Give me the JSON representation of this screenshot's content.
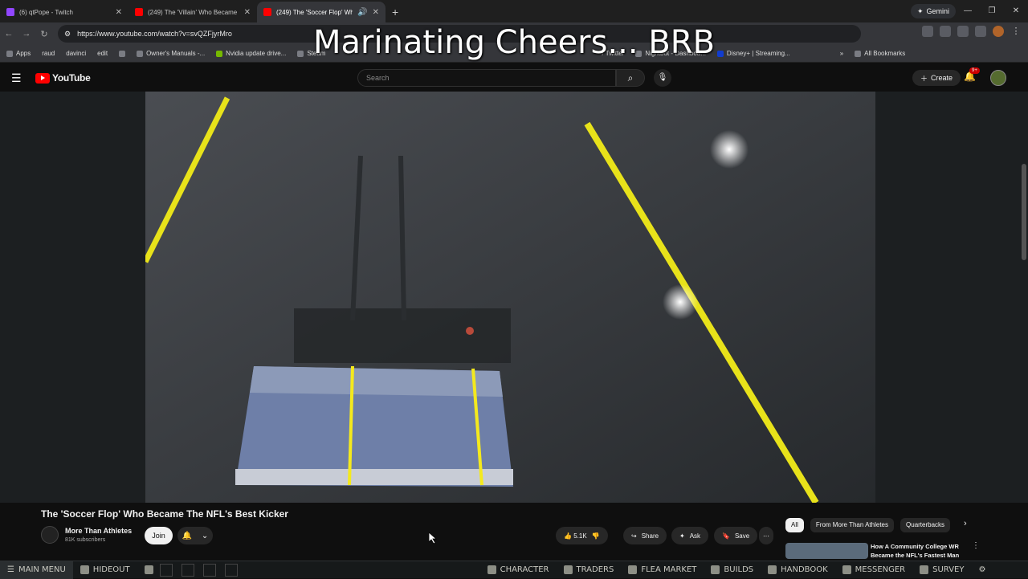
{
  "browser": {
    "tabs": [
      {
        "title": "(6) qtPope - Twitch",
        "color": "#9146ff",
        "active": false
      },
      {
        "title": "(249) The 'Villain' Who Became",
        "color": "#ff0000",
        "active": false
      },
      {
        "title": "(249) The 'Soccer Flop' Wh",
        "color": "#ff0000",
        "active": true
      }
    ],
    "new_tab": "+",
    "gemini": "Gemini",
    "url": "https://www.youtube.com/watch?v=svQZFjyrMro",
    "bookmarks": [
      "Apps",
      "raud",
      "davinci",
      "edit",
      "Owner's Manuals -...",
      "Nvidia update drive...",
      "Steam",
      "Nightbot - Dashboa...",
      "Disney+ | Streaming..."
    ],
    "bookmarks_end": "All Bookmarks",
    "twitter_bm": "/ Twitter"
  },
  "overlay_text": "Marinating Cheers... BRB",
  "youtube": {
    "logo": "YouTube",
    "search_placeholder": "Search",
    "create": "Create",
    "notif_badge": "9+"
  },
  "video": {
    "title": "The 'Soccer Flop' Who Became The NFL's Best Kicker",
    "channel": "More Than Athletes",
    "subscribers": "81K subscribers",
    "join": "Join",
    "likes": "5.1K",
    "share": "Share",
    "ask": "Ask",
    "save": "Save"
  },
  "chips": [
    "All",
    "From More Than Athletes",
    "Quarterbacks"
  ],
  "recommendation": {
    "title": "How A Community College WR Became the NFL's Fastest Man"
  },
  "gamebar": {
    "main_menu": "MAIN MENU",
    "hideout": "HIDEOUT",
    "character": "CHARACTER",
    "traders": "TRADERS",
    "flea_market": "FLEA MARKET",
    "builds": "BUILDS",
    "handbook": "HANDBOOK",
    "messenger": "MESSENGER",
    "survey": "SURVEY"
  }
}
